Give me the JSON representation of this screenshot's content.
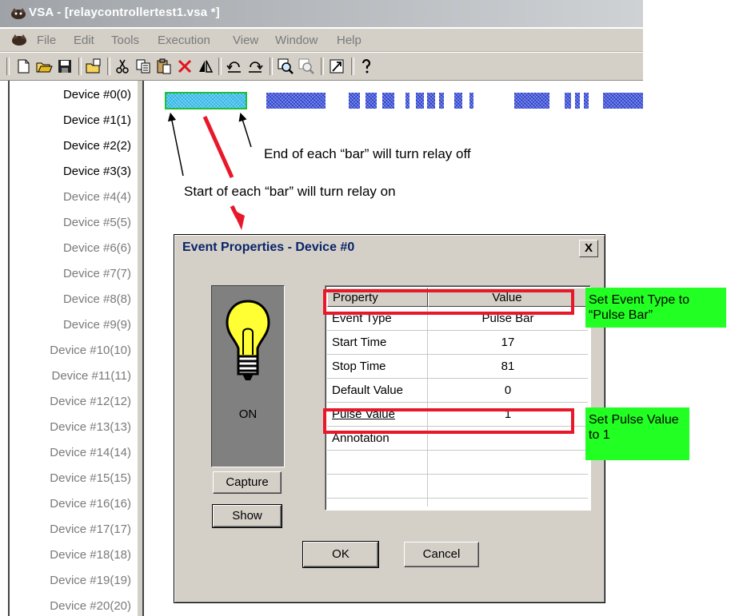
{
  "app": {
    "title": "VSA - [relaycontrollertest1.vsa *]"
  },
  "menu": {
    "items": [
      "File",
      "Edit",
      "Tools",
      "Execution",
      "View",
      "Window",
      "Help"
    ]
  },
  "toolbar": {
    "icons": [
      "new-file-icon",
      "open-folder-icon",
      "save-icon",
      "open-project-icon",
      "cut-icon",
      "copy-icon",
      "paste-icon",
      "delete-icon",
      "mirror-icon",
      "undo-icon",
      "redo-icon",
      "zoom-in-icon",
      "zoom-out-icon",
      "run-icon",
      "help-icon"
    ]
  },
  "devices": [
    {
      "label": "Device #0(0)",
      "active": true
    },
    {
      "label": "Device #1(1)",
      "active": true
    },
    {
      "label": "Device #2(2)",
      "active": true
    },
    {
      "label": "Device #3(3)",
      "active": true
    },
    {
      "label": "Device #4(4)",
      "active": false
    },
    {
      "label": "Device #5(5)",
      "active": false
    },
    {
      "label": "Device #6(6)",
      "active": false
    },
    {
      "label": "Device #7(7)",
      "active": false
    },
    {
      "label": "Device #8(8)",
      "active": false
    },
    {
      "label": "Device #9(9)",
      "active": false
    },
    {
      "label": "Device #10(10)",
      "active": false
    },
    {
      "label": "Device #11(11)",
      "active": false
    },
    {
      "label": "Device #12(12)",
      "active": false
    },
    {
      "label": "Device #13(13)",
      "active": false
    },
    {
      "label": "Device #14(14)",
      "active": false
    },
    {
      "label": "Device #15(15)",
      "active": false
    },
    {
      "label": "Device #16(16)",
      "active": false
    },
    {
      "label": "Device #17(17)",
      "active": false
    },
    {
      "label": "Device #18(18)",
      "active": false
    },
    {
      "label": "Device #19(19)",
      "active": false
    },
    {
      "label": "Device #20(20)",
      "active": false
    }
  ],
  "annotations": {
    "end_note": "End of each “bar” will turn relay off",
    "start_note": "Start of each “bar” will turn relay on",
    "callout_event_type": "Set Event Type to “Pulse Bar”",
    "callout_pulse_value": "Set Pulse Value to 1"
  },
  "dialog": {
    "title": "Event Properties - Device #0",
    "close_label": "X",
    "state_label": "ON",
    "capture_label": "Capture",
    "show_label": "Show",
    "ok_label": "OK",
    "cancel_label": "Cancel",
    "columns": [
      "Property",
      "Value"
    ],
    "rows": [
      {
        "property": "Event Type",
        "value": "Pulse Bar"
      },
      {
        "property": "Start Time",
        "value": "17"
      },
      {
        "property": "Stop Time",
        "value": "81"
      },
      {
        "property": "Default Value",
        "value": "0"
      },
      {
        "property": "Pulse Value",
        "value": "1"
      },
      {
        "property": "Annotation",
        "value": ""
      },
      {
        "property": "",
        "value": ""
      },
      {
        "property": "",
        "value": ""
      }
    ]
  },
  "colors": {
    "bar": "#2a3fcf",
    "selected_bar": "#2ab4e6",
    "highlight": "#e8182a",
    "callout": "#22ff22",
    "inactive_text": "#7a7a7a"
  }
}
